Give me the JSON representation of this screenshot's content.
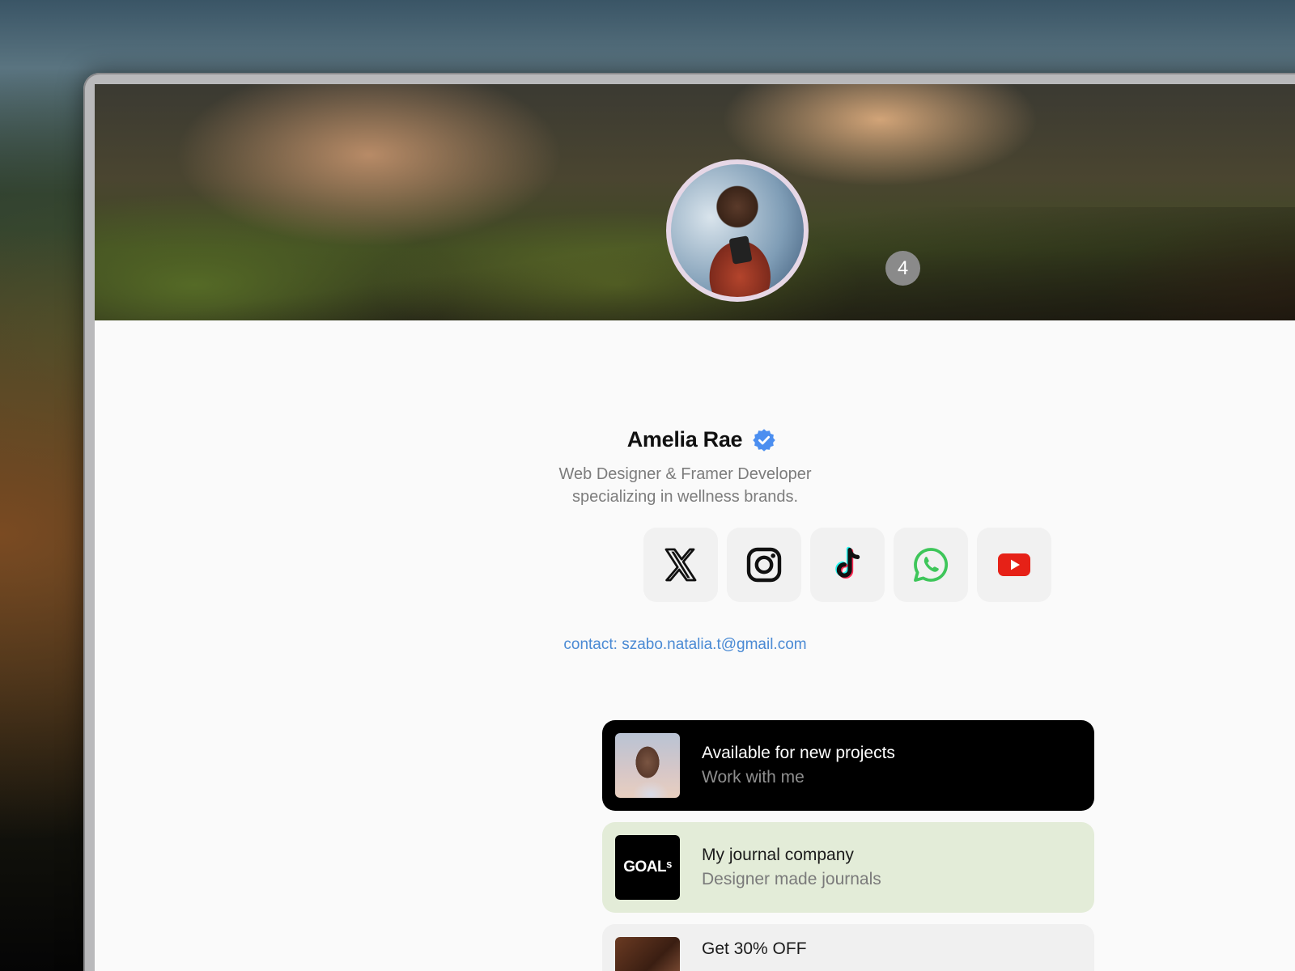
{
  "profile": {
    "name": "Amelia Rae",
    "notification_count": "4",
    "bio_line1": "Web Designer & Framer Developer",
    "bio_line2": "specializing in wellness brands.",
    "contact": "contact: szabo.natalia.t@gmail.com"
  },
  "socials": [
    {
      "icon": "x-icon"
    },
    {
      "icon": "instagram-icon"
    },
    {
      "icon": "tiktok-icon"
    },
    {
      "icon": "whatsapp-icon"
    },
    {
      "icon": "youtube-icon"
    }
  ],
  "cards": [
    {
      "title": "Available for new projects",
      "subtitle": "Work with me"
    },
    {
      "title": "My journal company",
      "subtitle": "Designer made journals",
      "logo_text": "GOALˢ"
    },
    {
      "title": "Get 30% OFF"
    }
  ],
  "colors": {
    "accent_blue": "#4a8ad4",
    "verified_blue": "#4b8ef0",
    "card_green": "#e3ecd8"
  }
}
